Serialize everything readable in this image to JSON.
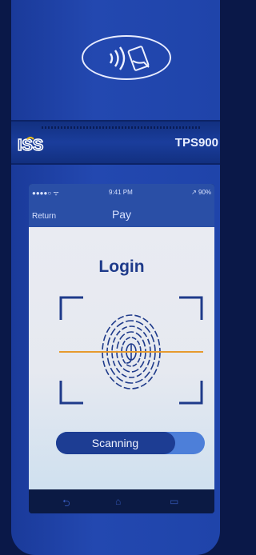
{
  "device": {
    "model": "TPS900",
    "logo_text": "ISS"
  },
  "status_bar": {
    "signal": "●●●●○ ᯤ",
    "time": "9:41 PM",
    "battery": "↗ 90%"
  },
  "nav": {
    "return_label": "Return",
    "title": "Pay"
  },
  "screen": {
    "heading": "Login",
    "scan_button_label": "Scanning",
    "scan_progress": 0.8
  },
  "icons": {
    "nfc": "contactless-payment-icon",
    "fingerprint": "fingerprint-icon",
    "back": "back-softkey-icon",
    "home": "home-softkey-icon",
    "recent": "recent-apps-softkey-icon"
  },
  "colors": {
    "body": "#2348b0",
    "accent": "#1e3a8a",
    "scan_line": "#e69a2e"
  }
}
